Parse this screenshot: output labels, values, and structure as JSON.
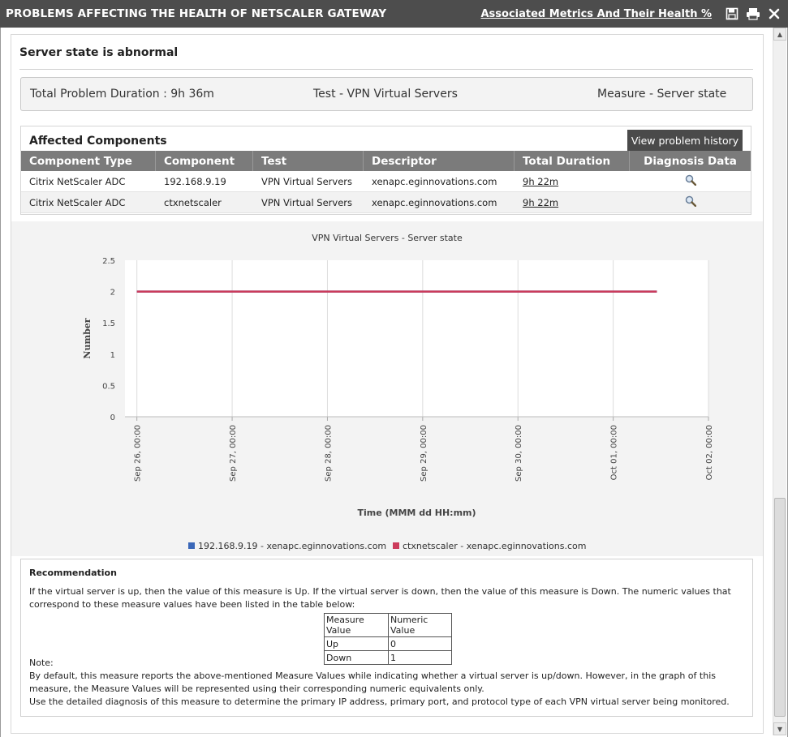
{
  "titlebar": {
    "title": "PROBLEMS AFFECTING THE HEALTH OF NETSCALER GATEWAY",
    "assoc_link": "Associated Metrics And Their Health %"
  },
  "problem": {
    "heading": "Server state is abnormal",
    "duration": "Total Problem Duration : 9h 36m",
    "test": "Test - VPN Virtual Servers",
    "measure": "Measure - Server state"
  },
  "affected": {
    "heading": "Affected Components",
    "history_button": "View problem history",
    "columns": [
      "Component Type",
      "Component",
      "Test",
      "Descriptor",
      "Total Duration",
      "Diagnosis Data"
    ],
    "rows": [
      {
        "type": "Citrix NetScaler ADC",
        "component": "192.168.9.19",
        "test": "VPN Virtual Servers",
        "descriptor": "xenapc.eginnovations.com",
        "duration": "9h 22m"
      },
      {
        "type": "Citrix NetScaler ADC",
        "component": "ctxnetscaler",
        "test": "VPN Virtual Servers",
        "descriptor": "xenapc.eginnovations.com",
        "duration": "9h 22m"
      }
    ]
  },
  "chart_data": {
    "type": "line",
    "title": "VPN Virtual Servers - Server state",
    "xlabel": "Time (MMM dd HH:mm)",
    "ylabel": "Number",
    "ylim": [
      0,
      2.5
    ],
    "yticks": [
      "0",
      "0.5",
      "1",
      "1.5",
      "2",
      "2.5"
    ],
    "xticks": [
      "Sep 26, 00:00",
      "Sep 27, 00:00",
      "Sep 28, 00:00",
      "Sep 29, 00:00",
      "Sep 30, 00:00",
      "Oct 01, 00:00",
      "Oct 02, 00:00"
    ],
    "xrange": [
      "Sep 25, 21:00",
      "Oct 02, 00:00"
    ],
    "grid": true,
    "legend_position": "bottom",
    "series": [
      {
        "name": "192.168.9.19 - xenapc.eginnovations.com",
        "color": "#3a67b8",
        "x": [
          "Sep 26, 00:00",
          "Oct 01, 11:00"
        ],
        "y": [
          2,
          2
        ]
      },
      {
        "name": "ctxnetscaler - xenapc.eginnovations.com",
        "color": "#cc3b5b",
        "x": [
          "Sep 26, 00:00",
          "Oct 01, 11:00"
        ],
        "y": [
          2,
          2
        ]
      }
    ]
  },
  "recommendation": {
    "heading": "Recommendation",
    "para1": "If the virtual server is up, then the value of this measure is Up. If the virtual server is down, then the value of this measure is Down. The numeric values that correspond to these measure values have been listed in the table below:",
    "table_header": [
      "Measure Value",
      "Numeric Value"
    ],
    "table_rows": [
      [
        "Up",
        "0"
      ],
      [
        "Down",
        "1"
      ]
    ],
    "note_label": "Note:",
    "note1": "By default, this measure reports the above-mentioned Measure Values while indicating whether a virtual server is up/down. However, in the graph of this measure, the Measure Values will be represented using their corresponding numeric equivalents only.",
    "note2": "Use the detailed diagnosis of this measure to determine the primary IP address, primary port, and protocol type of each VPN virtual server being monitored."
  }
}
